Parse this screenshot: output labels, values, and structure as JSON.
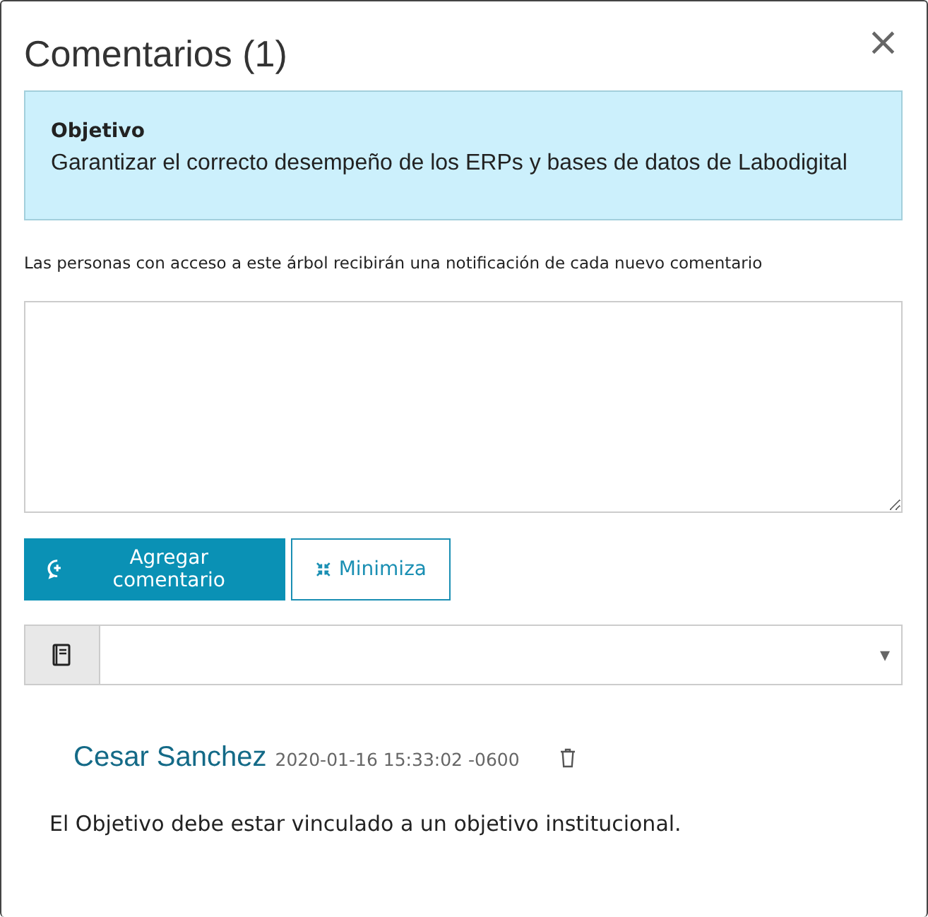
{
  "dialog": {
    "title": "Comentarios (1)",
    "close": "×"
  },
  "objective": {
    "heading": "Objetivo",
    "text": "Garantizar el correcto desempeño de los ERPs y bases de datos de Labodigital"
  },
  "notice": "Las personas con acceso a este árbol recibirán una notificación de cada nuevo comentario",
  "buttons": [
    {
      "kind": "primary",
      "label": "Agregar comentario"
    },
    {
      "kind": "outline",
      "label": "Minimiza"
    }
  ],
  "filter": {
    "arrow": "▾"
  },
  "comments": [
    {
      "author": "Cesar Sanchez",
      "time": "2020-01-16 15:33:02 -0600",
      "text": "El Objetivo debe estar vinculado a un objetivo institucional."
    }
  ]
}
